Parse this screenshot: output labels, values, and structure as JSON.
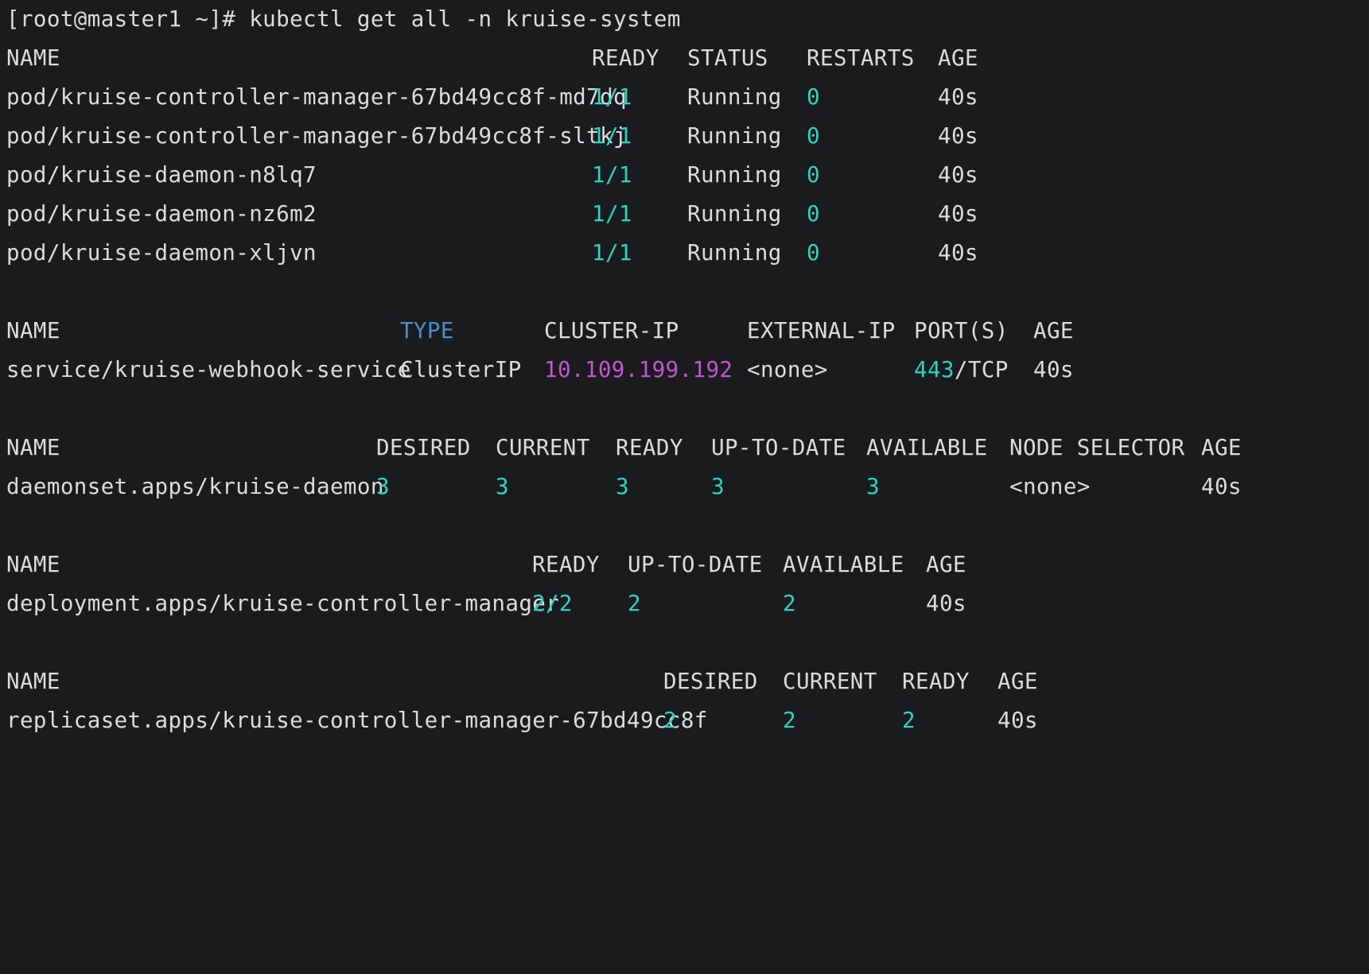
{
  "prompt": {
    "command_line": "[root@master1 ~]# kubectl get all -n kruise-system"
  },
  "colors": {
    "background": "#1a1b1d",
    "foreground": "#dcdcdc",
    "numeric_accent": "#2bd4c4",
    "ip_accent": "#c554d6",
    "type_header_accent": "#4c8fd1"
  },
  "pods": {
    "headers": {
      "name": "NAME",
      "ready": "READY",
      "status": "STATUS",
      "restarts": "RESTARTS",
      "age": "AGE"
    },
    "rows": [
      {
        "name": "pod/kruise-controller-manager-67bd49cc8f-md7dq",
        "ready": "1/1",
        "status": "Running",
        "restarts": "0",
        "age": "40s"
      },
      {
        "name": "pod/kruise-controller-manager-67bd49cc8f-sltkj",
        "ready": "1/1",
        "status": "Running",
        "restarts": "0",
        "age": "40s"
      },
      {
        "name": "pod/kruise-daemon-n8lq7",
        "ready": "1/1",
        "status": "Running",
        "restarts": "0",
        "age": "40s"
      },
      {
        "name": "pod/kruise-daemon-nz6m2",
        "ready": "1/1",
        "status": "Running",
        "restarts": "0",
        "age": "40s"
      },
      {
        "name": "pod/kruise-daemon-xljvn",
        "ready": "1/1",
        "status": "Running",
        "restarts": "0",
        "age": "40s"
      }
    ]
  },
  "services": {
    "headers": {
      "name": "NAME",
      "type": "TYPE",
      "cluster_ip": "CLUSTER-IP",
      "external_ip": "EXTERNAL-IP",
      "ports": "PORT(S)",
      "age": "AGE"
    },
    "rows": [
      {
        "name": "service/kruise-webhook-service",
        "type": "ClusterIP",
        "cluster_ip": "10.109.199.192",
        "external_ip": "<none>",
        "port_number": "443",
        "port_protocol": "/TCP",
        "age": "40s"
      }
    ]
  },
  "daemonsets": {
    "headers": {
      "name": "NAME",
      "desired": "DESIRED",
      "current": "CURRENT",
      "ready": "READY",
      "up_to_date": "UP-TO-DATE",
      "available": "AVAILABLE",
      "node_selector": "NODE SELECTOR",
      "age": "AGE"
    },
    "rows": [
      {
        "name": "daemonset.apps/kruise-daemon",
        "desired": "3",
        "current": "3",
        "ready": "3",
        "up_to_date": "3",
        "available": "3",
        "node_selector": "<none>",
        "age": "40s"
      }
    ]
  },
  "deployments": {
    "headers": {
      "name": "NAME",
      "ready": "READY",
      "up_to_date": "UP-TO-DATE",
      "available": "AVAILABLE",
      "age": "AGE"
    },
    "rows": [
      {
        "name": "deployment.apps/kruise-controller-manager",
        "ready": "2/2",
        "up_to_date": "2",
        "available": "2",
        "age": "40s"
      }
    ]
  },
  "replicasets": {
    "headers": {
      "name": "NAME",
      "desired": "DESIRED",
      "current": "CURRENT",
      "ready": "READY",
      "age": "AGE"
    },
    "rows": [
      {
        "name": "replicaset.apps/kruise-controller-manager-67bd49cc8f",
        "desired": "2",
        "current": "2",
        "ready": "2",
        "age": "40s"
      }
    ]
  }
}
